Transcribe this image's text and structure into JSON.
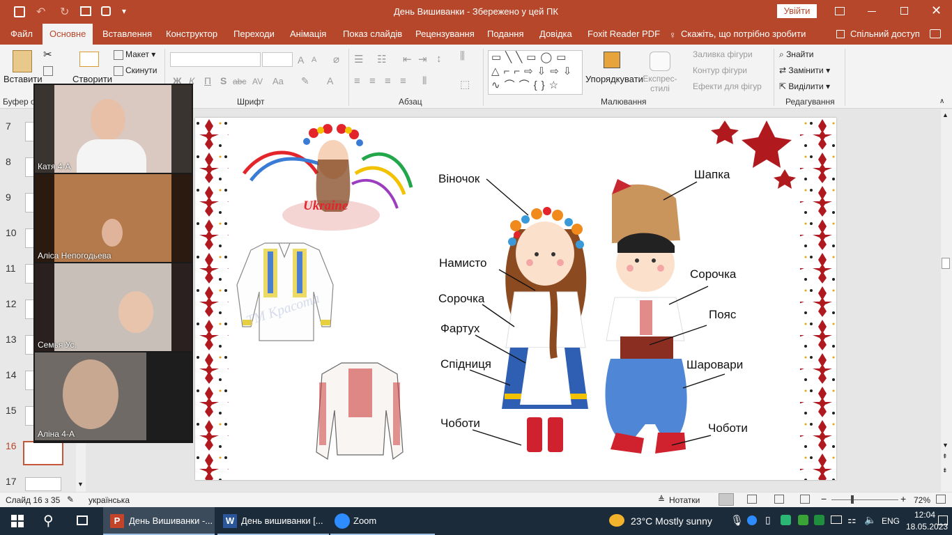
{
  "titlebar": {
    "title": "День Вишиванки  -  Збережено у цей ПК",
    "signin": "Увійти"
  },
  "tabs": [
    "Файл",
    "Основне",
    "Вставлення",
    "Конструктор",
    "Переходи",
    "Анімація",
    "Показ слайдів",
    "Рецензування",
    "Подання",
    "Довідка",
    "Foxit Reader PDF",
    "Скажіть, що потрібно зробити",
    "Спільний доступ"
  ],
  "ribbon": {
    "paste": "Вставити",
    "clipboard_group": "Буфер о",
    "new_slide": "Створити",
    "layout": "Макет",
    "reset": "Скинути",
    "font_group": "Шрифт",
    "paragraph_group": "Абзац",
    "drawing_group": "Малювання",
    "editing_group": "Редагування",
    "arrange": "Упорядкувати",
    "quick_styles": "Експрес-стилі",
    "fill": "Заливка фігури",
    "outline": "Контур фігури",
    "effects": "Ефекти для фігур",
    "find": "Знайти",
    "replace": "Замінити",
    "select": "Виділити",
    "fmt": {
      "bold": "Ж",
      "italic": "К",
      "underline": "П",
      "shadow": "S",
      "strike": "abc",
      "spacing": "AV",
      "case": "Aa"
    }
  },
  "slides": [
    {
      "num": "7"
    },
    {
      "num": "8"
    },
    {
      "num": "9"
    },
    {
      "num": "10"
    },
    {
      "num": "11"
    },
    {
      "num": "12"
    },
    {
      "num": "13"
    },
    {
      "num": "14"
    },
    {
      "num": "15"
    },
    {
      "num": "16"
    },
    {
      "num": "17"
    }
  ],
  "zoom_participants": [
    "Катя  4-А",
    "Аліса Непогодьева",
    "Семья Ус.",
    "Аліна 4-А"
  ],
  "slide_labels": {
    "vinochok": "Віночок",
    "namysto": "Намисто",
    "sorochka_left": "Сорочка",
    "fartukh": "Фартух",
    "spidnytsia": "Спідниця",
    "choboty_left": "Чоботи",
    "shapka": "Шапка",
    "sorochka_right": "Сорочка",
    "poyas": "Пояс",
    "sharovary": "Шаровари",
    "choboty_right": "Чоботи",
    "ukraine": "Ukraine",
    "watermark": "ТМ Красота"
  },
  "statusbar": {
    "slide": "Слайд 16 з 35",
    "language": "українська",
    "notes": "Нотатки",
    "zoom": "72%"
  },
  "taskbar": {
    "apps": [
      "День Вишиванки -...",
      "День вишиванки [...",
      "Zoom"
    ],
    "weather": "23°C  Mostly sunny",
    "lang": "ENG",
    "time": "12:04",
    "date": "18.05.2023"
  }
}
